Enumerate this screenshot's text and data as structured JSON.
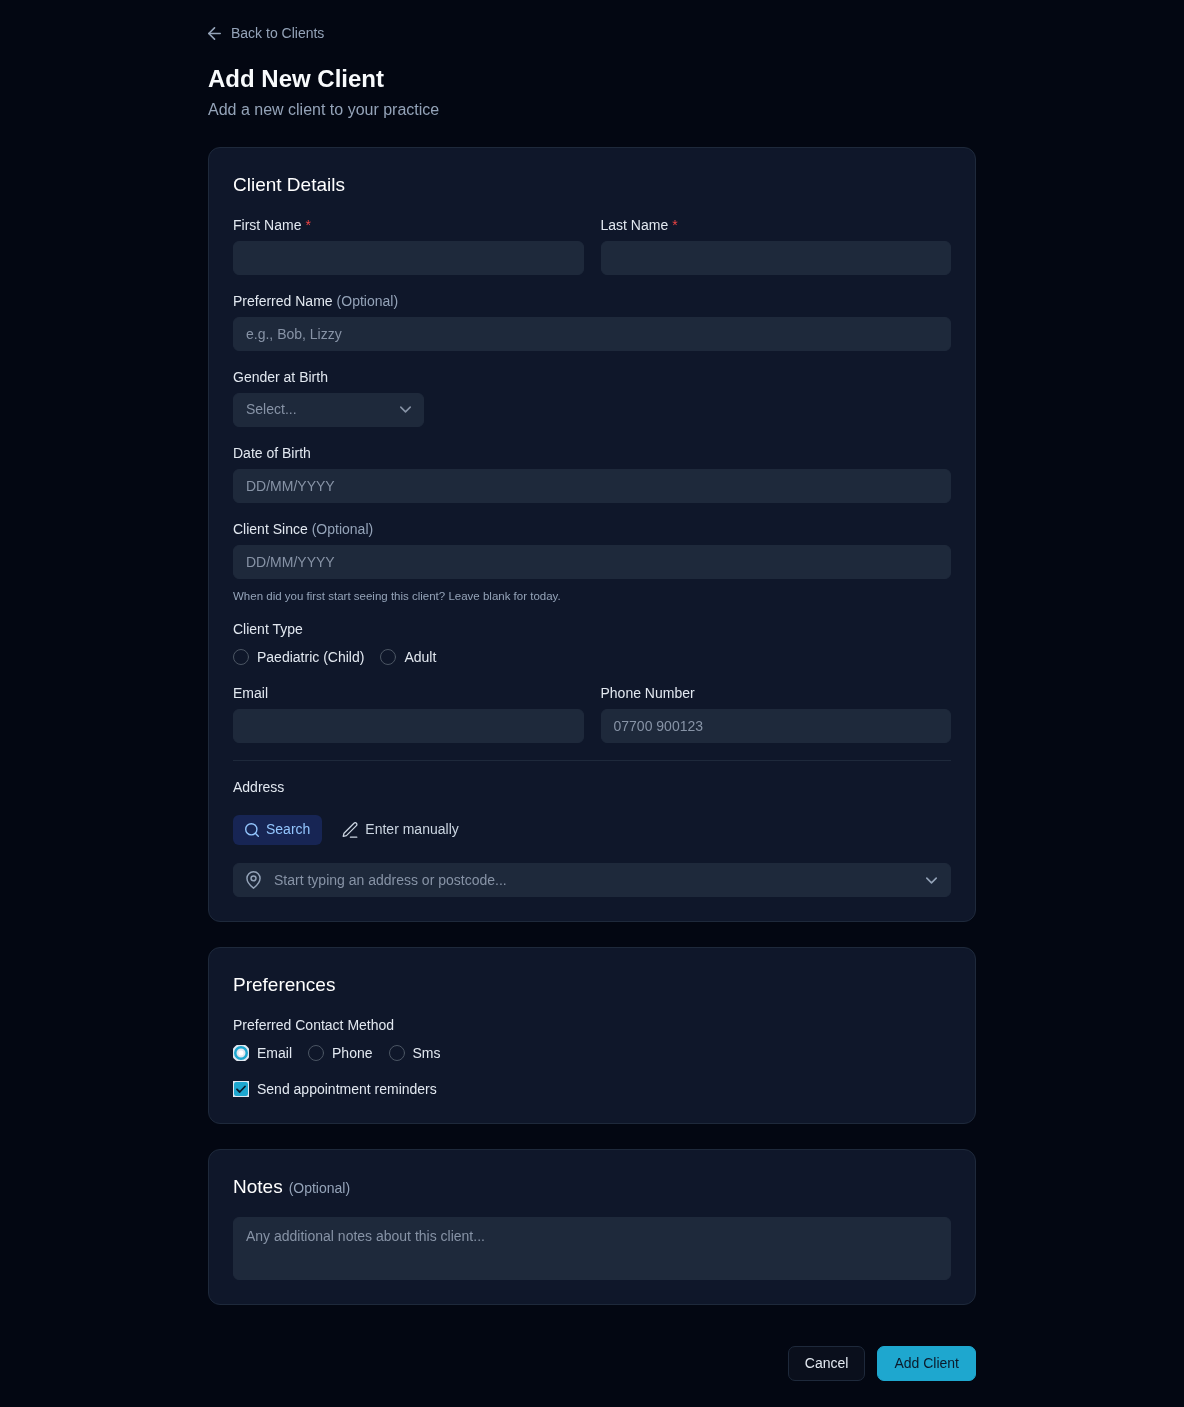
{
  "back_link": {
    "label": "Back to Clients"
  },
  "header": {
    "title": "Add New Client",
    "subtitle": "Add a new client to your practice"
  },
  "sections": [
    {
      "title": "Client Details",
      "rows": [
        {
          "fields": [
            {
              "kind": "text",
              "label": "First Name",
              "required_mark": "*"
            },
            {
              "kind": "text",
              "label": "Last Name",
              "required_mark": "*"
            }
          ]
        },
        {
          "fields": [
            {
              "kind": "text",
              "label": "Preferred Name",
              "note": "(Optional)",
              "placeholder": "e.g., Bob, Lizzy"
            }
          ]
        },
        {
          "fields": [
            {
              "kind": "select",
              "label": "Gender at Birth",
              "placeholder": "Select..."
            }
          ]
        },
        {
          "fields": [
            {
              "kind": "text",
              "label": "Date of Birth",
              "placeholder": "DD/MM/YYYY"
            }
          ]
        },
        {
          "fields": [
            {
              "kind": "text",
              "label": "Client Since",
              "note": "(Optional)",
              "placeholder": "DD/MM/YYYY",
              "help": "When did you first start seeing this client? Leave blank for today."
            }
          ]
        },
        {
          "fields": [
            {
              "kind": "radio",
              "label": "Client Type",
              "options": [
                {
                  "label": "Paediatric (Child)",
                  "selected": false
                },
                {
                  "label": "Adult",
                  "selected": false
                }
              ]
            }
          ]
        },
        {
          "fields": [
            {
              "kind": "text",
              "label": "Email"
            },
            {
              "kind": "text",
              "label": "Phone Number",
              "placeholder": "07700 900123"
            }
          ]
        },
        {
          "fields": [
            {
              "kind": "address",
              "label": "Address",
              "modes": [
                {
                  "kind": "search",
                  "label": "Search",
                  "selected": true
                },
                {
                  "kind": "manual",
                  "label": "Enter manually",
                  "selected": false
                }
              ],
              "placeholder": "Start typing an address or postcode..."
            }
          ]
        }
      ]
    },
    {
      "title": "Preferences",
      "rows": [
        {
          "fields": [
            {
              "kind": "radio",
              "label": "Preferred Contact Method",
              "options": [
                {
                  "label": "Email",
                  "selected": true
                },
                {
                  "label": "Phone",
                  "selected": false
                },
                {
                  "label": "Sms",
                  "selected": false
                }
              ]
            }
          ]
        },
        {
          "fields": [
            {
              "kind": "checkbox",
              "label": "Send appointment reminders",
              "checked": true
            }
          ]
        }
      ]
    },
    {
      "title": "Notes",
      "title_note": "(Optional)",
      "rows": [
        {
          "fields": [
            {
              "kind": "textarea",
              "placeholder": "Any additional notes about this client..."
            }
          ]
        }
      ]
    }
  ],
  "actions": [
    {
      "kind": "secondary",
      "label": "Cancel"
    },
    {
      "kind": "primary",
      "label": "Add Client"
    }
  ]
}
